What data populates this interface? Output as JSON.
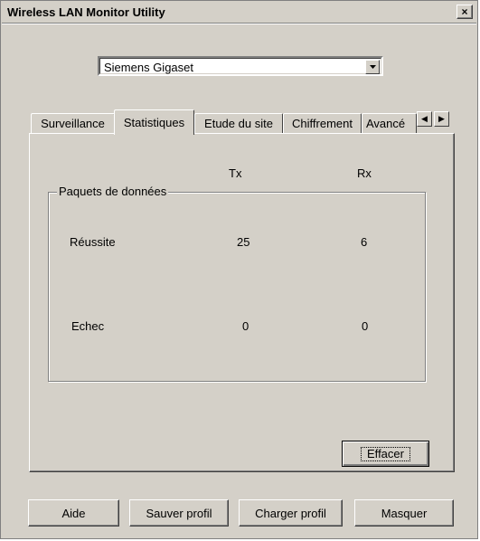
{
  "window": {
    "title": "Wireless LAN Monitor Utility",
    "close_label": "×"
  },
  "adapter": {
    "selected": "Siemens Gigaset"
  },
  "tabs": [
    {
      "label": "Surveillance"
    },
    {
      "label": "Statistiques"
    },
    {
      "label": "Etude du site"
    },
    {
      "label": "Chiffrement"
    },
    {
      "label": "Avancé"
    }
  ],
  "stats": {
    "tx_header": "Tx",
    "rx_header": "Rx",
    "group_label": "Paquets de données",
    "rows": [
      {
        "label": "Réussite",
        "tx": "25",
        "rx": "6"
      },
      {
        "label": "Echec",
        "tx": "0",
        "rx": "0"
      }
    ],
    "clear_label": "Effacer"
  },
  "buttons": {
    "help": "Aide",
    "save_profile": "Sauver profil",
    "load_profile": "Charger profil",
    "hide": "Masquer"
  }
}
